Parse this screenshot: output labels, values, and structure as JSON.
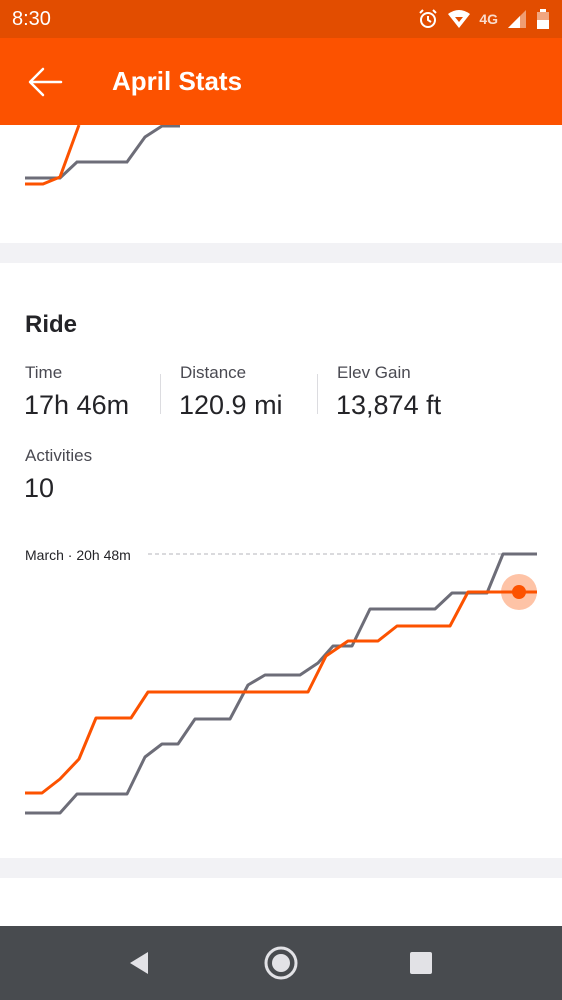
{
  "status_bar": {
    "time": "8:30",
    "network": "4G",
    "icons": [
      "alarm-icon",
      "wifi-icon",
      "signal-icon",
      "battery-icon"
    ]
  },
  "toolbar": {
    "title": "April Stats",
    "back_icon": "back-arrow-icon"
  },
  "ride": {
    "title": "Ride",
    "stats": [
      {
        "label": "Time",
        "value": "17h 46m"
      },
      {
        "label": "Distance",
        "value": "120.9 mi"
      },
      {
        "label": "Elev Gain",
        "value": "13,874 ft"
      },
      {
        "label": "Activities",
        "value": "10"
      }
    ],
    "reference_label": "March · 20h 48m"
  },
  "colors": {
    "brand": "#fc5200",
    "status_bar": "#e24d00",
    "current_month": "#fc5200",
    "previous_month": "#6d6d78",
    "nav_bar": "#484b4f"
  },
  "nav_bar": {
    "icons": [
      "back-triangle-icon",
      "home-circle-icon",
      "recents-square-icon"
    ]
  }
}
